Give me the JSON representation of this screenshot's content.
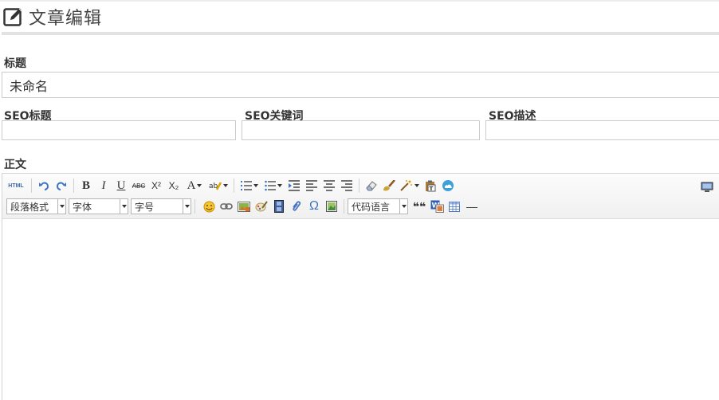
{
  "header": {
    "title": "文章编辑"
  },
  "form": {
    "title_label": "标题",
    "title_value": "未命名",
    "seo_title_label": "SEO标题",
    "seo_title_value": "",
    "seo_keywords_label": "SEO关键词",
    "seo_keywords_value": "",
    "seo_desc_label": "SEO描述",
    "seo_desc_value": "",
    "body_label": "正文"
  },
  "editor": {
    "source_label": "HTML",
    "bold_label": "B",
    "italic_label": "I",
    "underline_label": "U",
    "strike_label": "ABC",
    "sup_label": "X²",
    "sub_label": "X₂",
    "fontcolor_label": "A",
    "paragraph_combo": "段落格式",
    "font_combo": "字体",
    "size_combo": "字号",
    "code_combo": "代码语言",
    "omega_label": "Ω",
    "quote_label": "❝❝",
    "hr_label": "—"
  }
}
